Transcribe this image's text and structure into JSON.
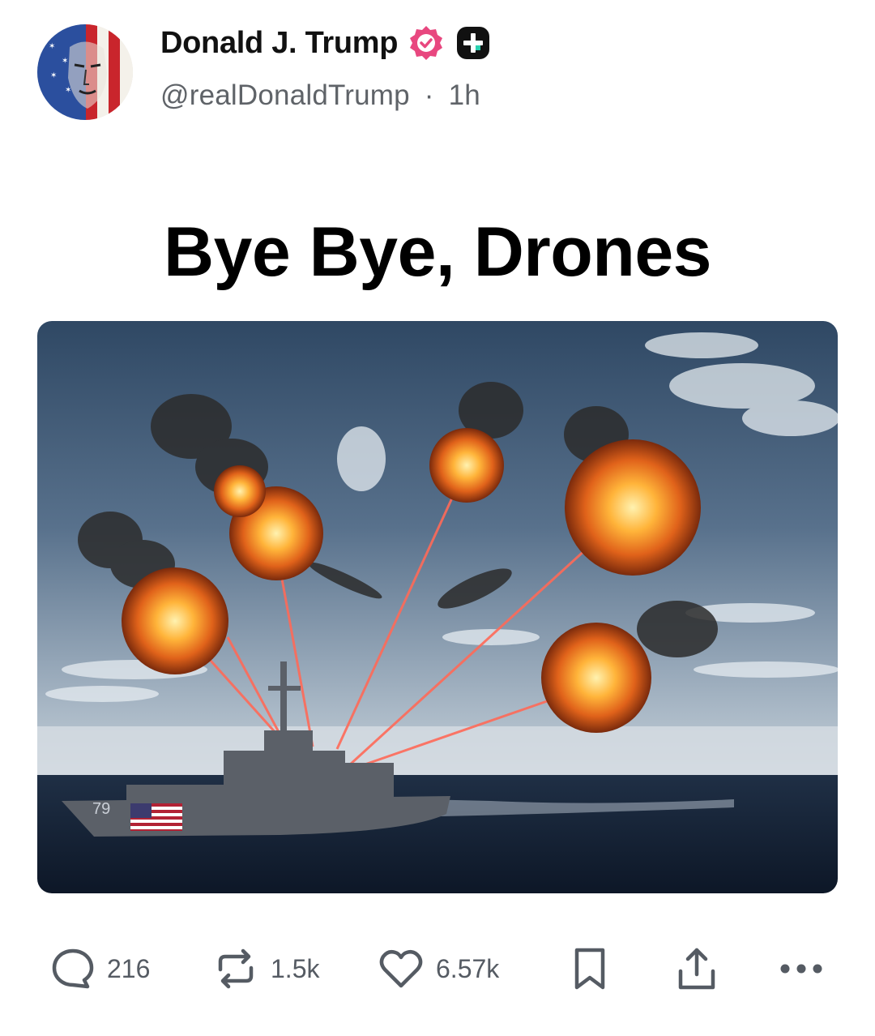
{
  "post": {
    "author_name": "Donald J. Trump",
    "handle": "@realDonaldTrump",
    "separator": "·",
    "timestamp": "1h",
    "headline": "Bye Bye, Drones",
    "ship_hull_number": "79"
  },
  "icons": {
    "avatar": "avatar-flag-portrait",
    "verified": "verified-badge-icon",
    "plus": "plus-badge-icon",
    "reply": "reply-icon",
    "repost": "repost-icon",
    "like": "heart-icon",
    "bookmark": "bookmark-icon",
    "share": "share-icon",
    "more": "more-icon"
  },
  "actions": {
    "replies": "216",
    "reposts": "1.5k",
    "likes": "6.57k"
  },
  "colors": {
    "verified": "#e8477f",
    "icon_gray": "#555b63",
    "handle_gray": "#5f6368"
  }
}
